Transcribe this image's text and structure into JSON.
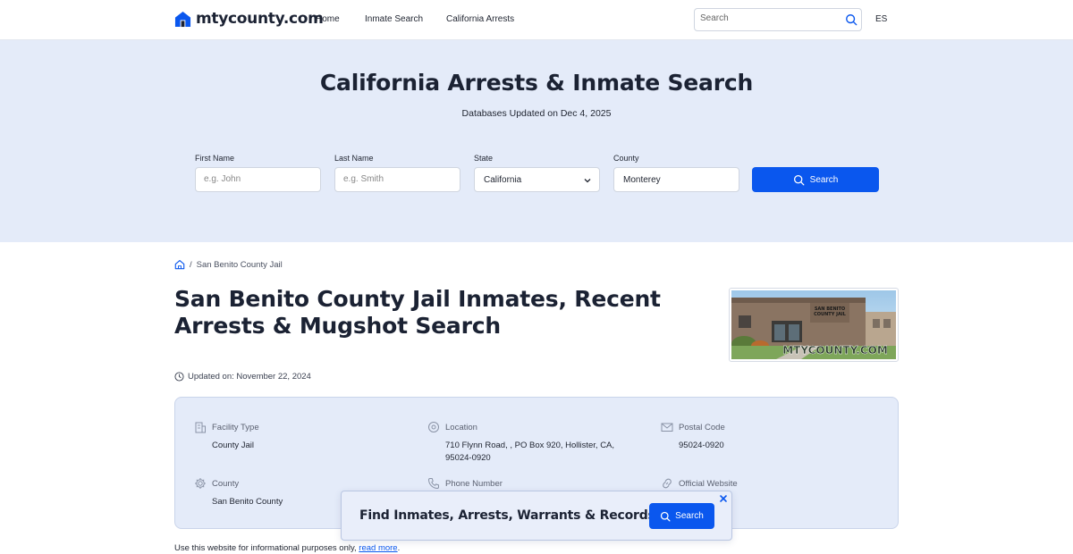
{
  "header": {
    "logo_text": "mtycounty.com",
    "nav": {
      "home": "Home",
      "inmate_search": "Inmate Search",
      "california_arrests": "California Arrests"
    },
    "search_placeholder": "Search",
    "language": "ES"
  },
  "hero": {
    "title": "California Arrests & Inmate Search",
    "subtitle": "Databases Updated on Dec 4, 2025",
    "first_name_label": "First Name",
    "first_name_placeholder": "e.g. John",
    "last_name_label": "Last Name",
    "last_name_placeholder": "e.g. Smith",
    "state_label": "State",
    "state_value": "California",
    "county_label": "County",
    "county_value": "Monterey",
    "search_button": "Search"
  },
  "breadcrumb": {
    "separator": "/",
    "current": "San Benito County Jail"
  },
  "page": {
    "title": "San Benito County Jail Inmates, Recent Arrests & Mugshot Search",
    "updated": "Updated on: November 22, 2024",
    "photo_watermark": "MTYCOUNTY.COM",
    "photo_sign": "SAN BENITO COUNTY JAIL"
  },
  "info": {
    "facility_type_label": "Facility Type",
    "facility_type_value": "County Jail",
    "location_label": "Location",
    "location_value": "710 Flynn Road, , PO Box 920, Hollister, CA, 95024-0920",
    "postal_code_label": "Postal Code",
    "postal_code_value": "95024-0920",
    "county_label": "County",
    "county_value": "San Benito County",
    "phone_label": "Phone Number",
    "website_label": "Official Website"
  },
  "disclaimer": {
    "text": "Use this website for informational purposes only,",
    "link": "read more",
    "end": "."
  },
  "banner": {
    "text": "Find Inmates, Arrests, Warrants & Records",
    "button": "Search"
  },
  "colors": {
    "accent": "#0a57ee",
    "hero_bg": "#e4ebf9",
    "text": "#1b2233"
  }
}
